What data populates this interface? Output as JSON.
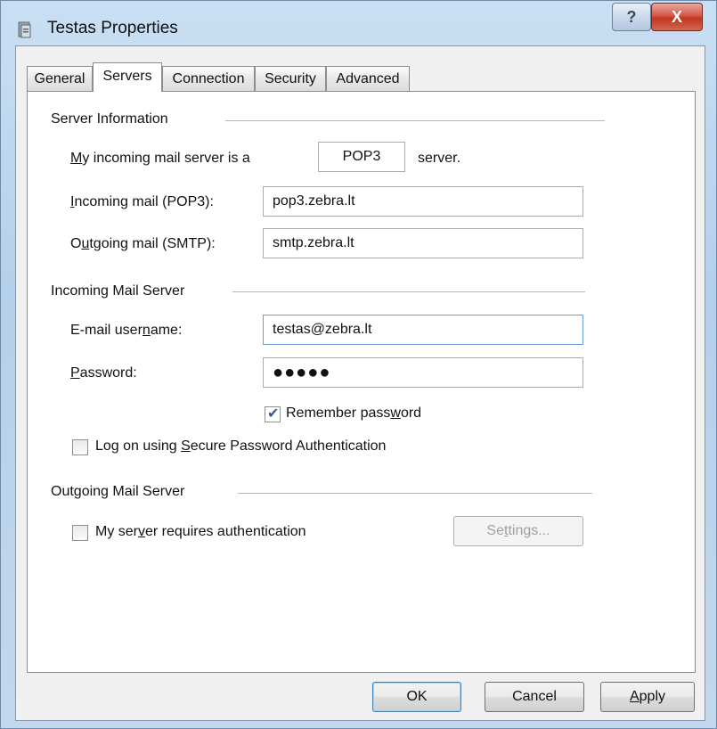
{
  "window": {
    "title": "Testas Properties",
    "help_glyph": "?",
    "close_glyph": "X"
  },
  "tabs": [
    {
      "label": "General"
    },
    {
      "label": "Servers"
    },
    {
      "label": "Connection"
    },
    {
      "label": "Security"
    },
    {
      "label": "Advanced"
    }
  ],
  "active_tab": "Servers",
  "server_info": {
    "group_title": "Server Information",
    "incoming_type_label_pre": "M",
    "incoming_type_label_post": "y incoming mail server is a",
    "incoming_type_value": "POP3",
    "incoming_type_suffix": "server.",
    "incoming_label_pre": "I",
    "incoming_label_post": "ncoming mail (POP3):",
    "incoming_value": "pop3.zebra.lt",
    "outgoing_label_pre": "O",
    "outgoing_label_mid": "u",
    "outgoing_label_post": "tgoing mail (SMTP):",
    "outgoing_value": "smtp.zebra.lt"
  },
  "incoming_server": {
    "group_title": "Incoming Mail Server",
    "username_label_pre": "E-mail user",
    "username_label_mid": "n",
    "username_label_post": "ame:",
    "username_value": "testas@zebra.lt",
    "password_label_pre": "P",
    "password_label_post": "assword:",
    "password_value": "●●●●●",
    "remember_label_pre": "Remember pass",
    "remember_label_mid": "w",
    "remember_label_post": "ord",
    "remember_checked": true,
    "spa_label_pre": "Log on using ",
    "spa_label_mid": "S",
    "spa_label_post": "ecure Password Authentication",
    "spa_checked": false
  },
  "outgoing_server": {
    "group_title": "Outgoing Mail Server",
    "auth_label_pre": "My ser",
    "auth_label_mid": "v",
    "auth_label_post": "er requires authentication",
    "auth_checked": false,
    "settings_pre": "Se",
    "settings_mid": "t",
    "settings_post": "tings..."
  },
  "buttons": {
    "ok": "OK",
    "cancel": "Cancel",
    "apply_pre": "",
    "apply_mid": "A",
    "apply_post": "pply"
  },
  "colors": {
    "frame": "#b5d0ea",
    "close_button": "#c3351f",
    "checkmark": "#3a5a8c"
  },
  "icons": {
    "window_icon": "mail-account-icon",
    "checkmark": "checkmark-icon"
  }
}
